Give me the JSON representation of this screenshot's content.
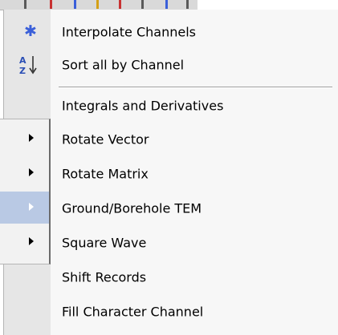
{
  "menu": {
    "items": [
      {
        "label": "Interpolate Channels",
        "icon": "asterisk-icon"
      },
      {
        "label": "Sort all by Channel",
        "icon": "sort-az-icon"
      },
      {
        "label": "Integrals and Derivatives"
      },
      {
        "label": "Rotate Vector",
        "submenu": true
      },
      {
        "label": "Rotate Matrix",
        "submenu": true
      },
      {
        "label": "Ground/Borehole TEM",
        "submenu": true,
        "highlighted": true
      },
      {
        "label": "Square Wave",
        "submenu": true
      },
      {
        "label": "Shift Records"
      },
      {
        "label": "Fill Character Channel"
      }
    ]
  },
  "colors": {
    "highlight": "#b9c9e4",
    "asterisk_icon": "#3a5fd9",
    "gutter": "#e6e6e6",
    "menu_background": "#f7f7f7"
  }
}
